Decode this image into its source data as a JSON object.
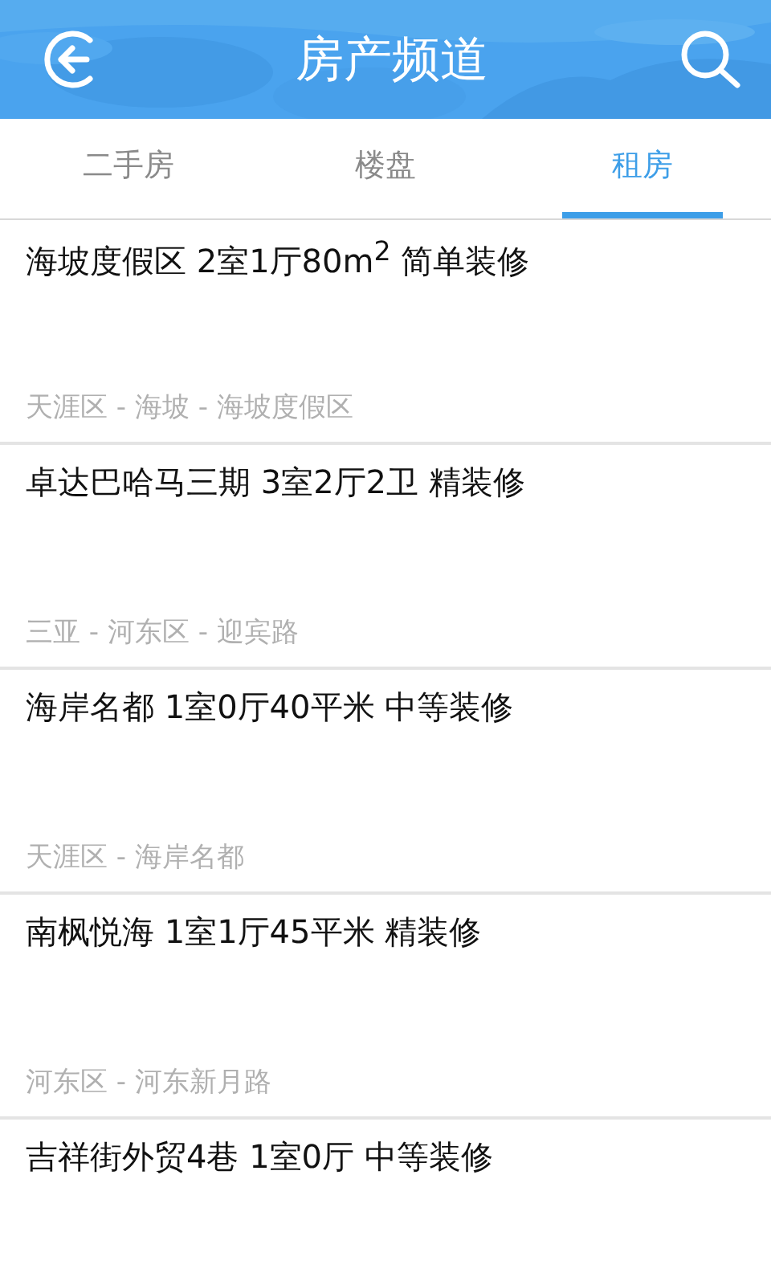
{
  "header": {
    "title": "房产频道"
  },
  "tabs": [
    {
      "label": "二手房",
      "selected": false
    },
    {
      "label": "楼盘",
      "selected": false
    },
    {
      "label": "租房",
      "selected": true
    }
  ],
  "listings": [
    {
      "title": "海坡度假区 2室1厅80m$^{2}$ 简单装修",
      "location": "天涯区 - 海坡 - 海坡度假区"
    },
    {
      "title": "卓达巴哈马三期 3室2厅2卫 精装修",
      "location": "三亚 - 河东区 - 迎宾路"
    },
    {
      "title": "海岸名都 1室0厅40平米 中等装修",
      "location": "天涯区 - 海岸名都"
    },
    {
      "title": "南枫悦海 1室1厅45平米 精装修",
      "location": "河东区 - 河东新月路"
    },
    {
      "title": "吉祥街外贸4巷 1室0厅 中等装修"
    }
  ]
}
